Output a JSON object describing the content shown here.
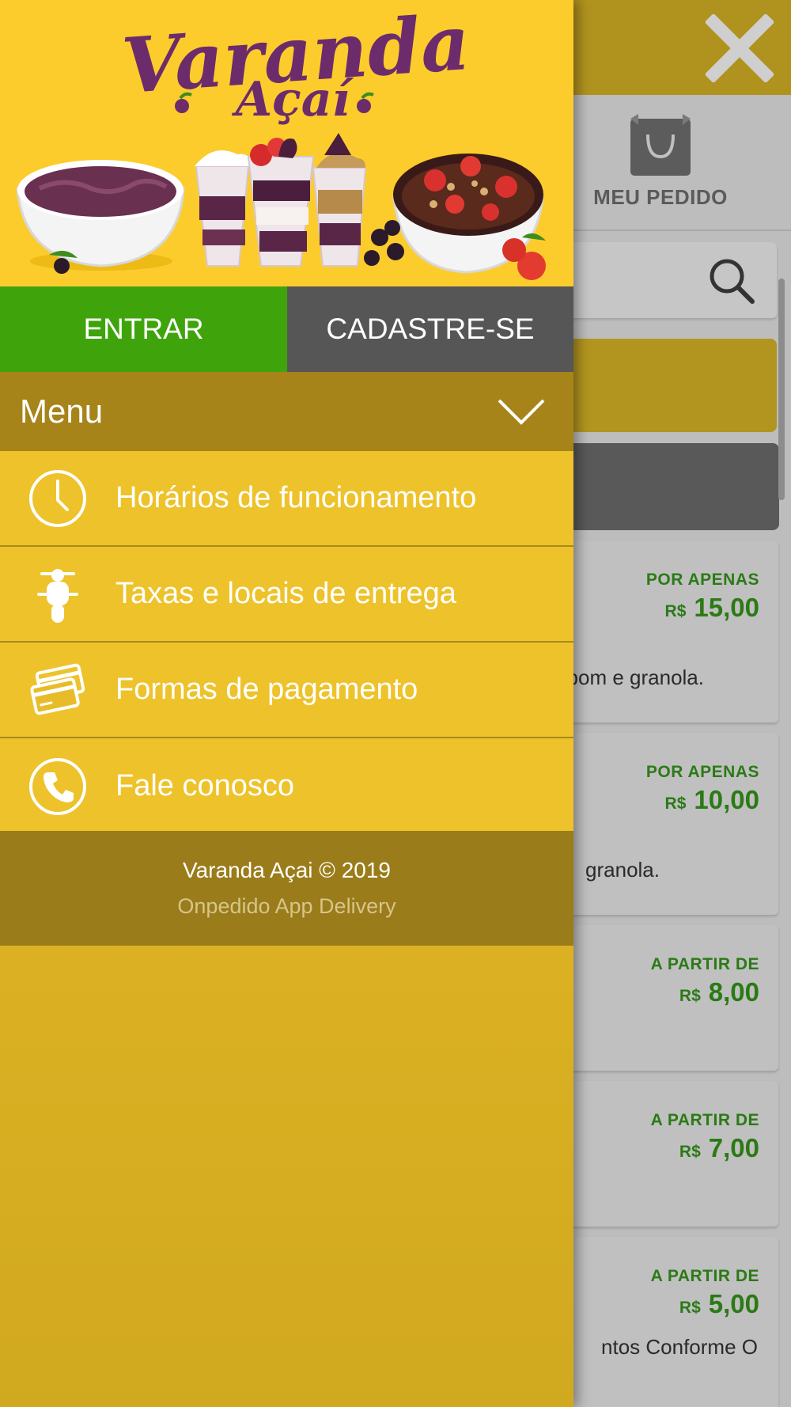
{
  "colors": {
    "brand_yellow": "#fccc2c",
    "brand_purple": "#6c2c6c",
    "login_green": "#3fa40c",
    "register_grey": "#565656",
    "price_green": "#2b7a16",
    "menu_header": "#a68419",
    "footer_bg": "#9a7c1a"
  },
  "drawer": {
    "banner": {
      "logo_line1": "Varanda",
      "logo_line2": "Açaí"
    },
    "auth": {
      "login_label": "ENTRAR",
      "register_label": "CADASTRE-SE"
    },
    "menu": {
      "title": "Menu",
      "toggle_icon": "chevron-down-icon",
      "items": [
        {
          "label": "Horários de funcionamento",
          "icon": "clock-icon"
        },
        {
          "label": "Taxas e locais de entrega",
          "icon": "scooter-icon"
        },
        {
          "label": "Formas de pagamento",
          "icon": "credit-cards-icon"
        },
        {
          "label": "Fale conosco",
          "icon": "phone-icon"
        }
      ]
    },
    "footer": {
      "copyright": "Varanda Açai © 2019",
      "powered_by": "Onpedido App Delivery"
    }
  },
  "background": {
    "close_icon": "close-icon",
    "order": {
      "label": "MEU PEDIDO",
      "icon": "shopping-bag-icon"
    },
    "search_icon": "search-icon",
    "products": [
      {
        "price_label": "POR APENAS",
        "currency": "R$",
        "price": "15,00",
        "desc": "bom e granola."
      },
      {
        "price_label": "POR APENAS",
        "currency": "R$",
        "price": "10,00",
        "desc": "granola."
      },
      {
        "price_label": "A PARTIR DE",
        "currency": "R$",
        "price": "8,00",
        "desc": ""
      },
      {
        "price_label": "A PARTIR DE",
        "currency": "R$",
        "price": "7,00",
        "desc": ""
      },
      {
        "price_label": "A PARTIR DE",
        "currency": "R$",
        "price": "5,00",
        "desc": "ntos Conforme O"
      }
    ]
  }
}
